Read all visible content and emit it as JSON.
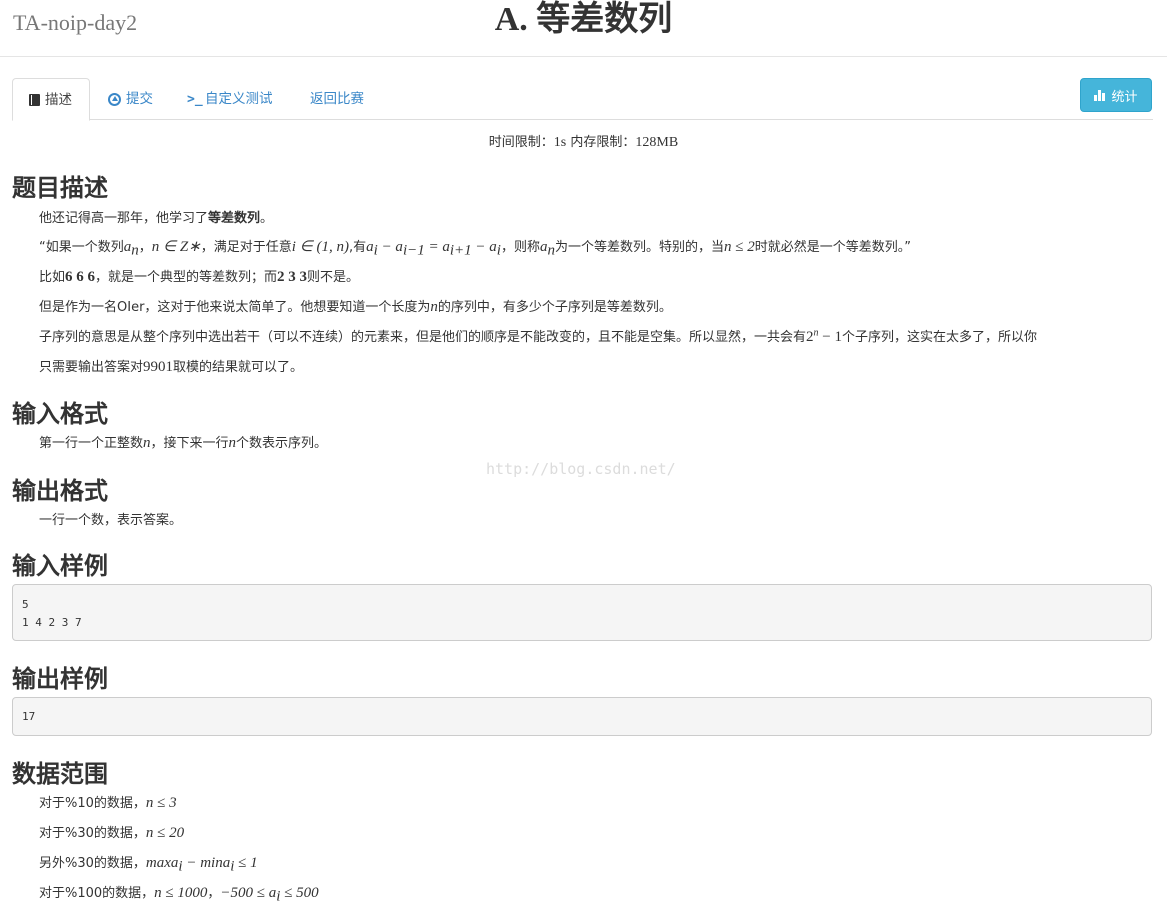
{
  "header": {
    "contest_name": "TA-noip-day2",
    "problem_title": "A. 等差数列"
  },
  "tabs": [
    {
      "label": "描述",
      "icon": "book-icon",
      "active": true
    },
    {
      "label": "提交",
      "icon": "upload-icon",
      "active": false
    },
    {
      "label": "自定义测试",
      "icon": "terminal-icon",
      "active": false
    },
    {
      "label": "返回比赛",
      "icon": "",
      "active": false
    }
  ],
  "stats_button": {
    "label": "统计",
    "icon": "bar-chart-icon"
  },
  "limits": {
    "time_label": "时间限制：",
    "time_value": "1s",
    "memory_label": "内存限制：",
    "memory_value": "128MB"
  },
  "sections": {
    "description": {
      "heading": "题目描述",
      "p1_prefix": "他还记得高一那年，他学习了",
      "p1_bold": "等差数列",
      "p1_suffix": "。",
      "p2_t1": "“如果一个数列",
      "p2_m1": "a",
      "p2_m1_sub": "n",
      "p2_t2": "，",
      "p2_m2": "n ∈ Z∗",
      "p2_t3": "，满足对于任意",
      "p2_m3": "i ∈ (1, n)",
      "p2_t4": ",有",
      "p2_m4": "a",
      "p2_m4_sub": "i",
      "p2_m5": " − a",
      "p2_m5_sub": "i−1",
      "p2_m6": " = a",
      "p2_m6_sub": "i+1",
      "p2_m7": " − a",
      "p2_m7_sub": "i",
      "p2_t5": "，则称",
      "p2_m8": "a",
      "p2_m8_sub": "n",
      "p2_t6": "为一个等差数列。特别的，当",
      "p2_m9": "n ≤ 2",
      "p2_t7": "时就必然是一个等差数列。”",
      "p3_t1": "比如",
      "p3_n1": "6 6 6",
      "p3_t2": "，就是一个典型的等差数列；而",
      "p3_n2": "2 3 3",
      "p3_t3": "则不是。",
      "p4_t1": "但是作为一名OIer，这对于他来说太简单了。他想要知道一个长度为",
      "p4_m1": "n",
      "p4_t2": "的序列中，有多少个子序列是等差数列。",
      "p5_t1": "子序列的意思是从整个序列中选出若干（可以不连续）的元素来，但是他们的顺序是不能改变的，且不能是空集。所以显然，一共会有",
      "p5_n1": "2",
      "p5_sup": "n",
      "p5_n2": " − 1",
      "p5_t2": "个子序列，这实在太多了，所以你",
      "p6_t1": "只需要输出答案对",
      "p6_n1": "9901",
      "p6_t2": "取模的结果就可以了。"
    },
    "input_format": {
      "heading": "输入格式",
      "t1": "第一行一个正整数",
      "m1": "n",
      "t2": "，接下来一行",
      "m2": "n",
      "t3": "个数表示序列。"
    },
    "output_format": {
      "heading": "输出格式",
      "text": "一行一个数，表示答案。"
    },
    "sample_input": {
      "heading": "输入样例",
      "content": "5\n1 4 2 3 7"
    },
    "sample_output": {
      "heading": "输出样例",
      "content": "17"
    },
    "data_range": {
      "heading": "数据范围",
      "r1_t": "对于%10的数据，",
      "r1_m": "n ≤ 3",
      "r2_t": "对于%30的数据，",
      "r2_m": "n ≤ 20",
      "r3_t": "另外%30的数据，",
      "r3_m1": "maxa",
      "r3_m1_sub": "i",
      "r3_m2": " − mina",
      "r3_m2_sub": "i",
      "r3_m3": " ≤ 1",
      "r4_t": "对于%100的数据，",
      "r4_m1": "n ≤ 1000",
      "r4_m2": "，",
      "r4_m3": "−500 ≤ a",
      "r4_m3_sub": "i",
      "r4_m4": " ≤ 500"
    }
  },
  "watermark": "http://blog.csdn.net/",
  "colors": {
    "link": "#3a87c8",
    "button": "#45b5da"
  }
}
